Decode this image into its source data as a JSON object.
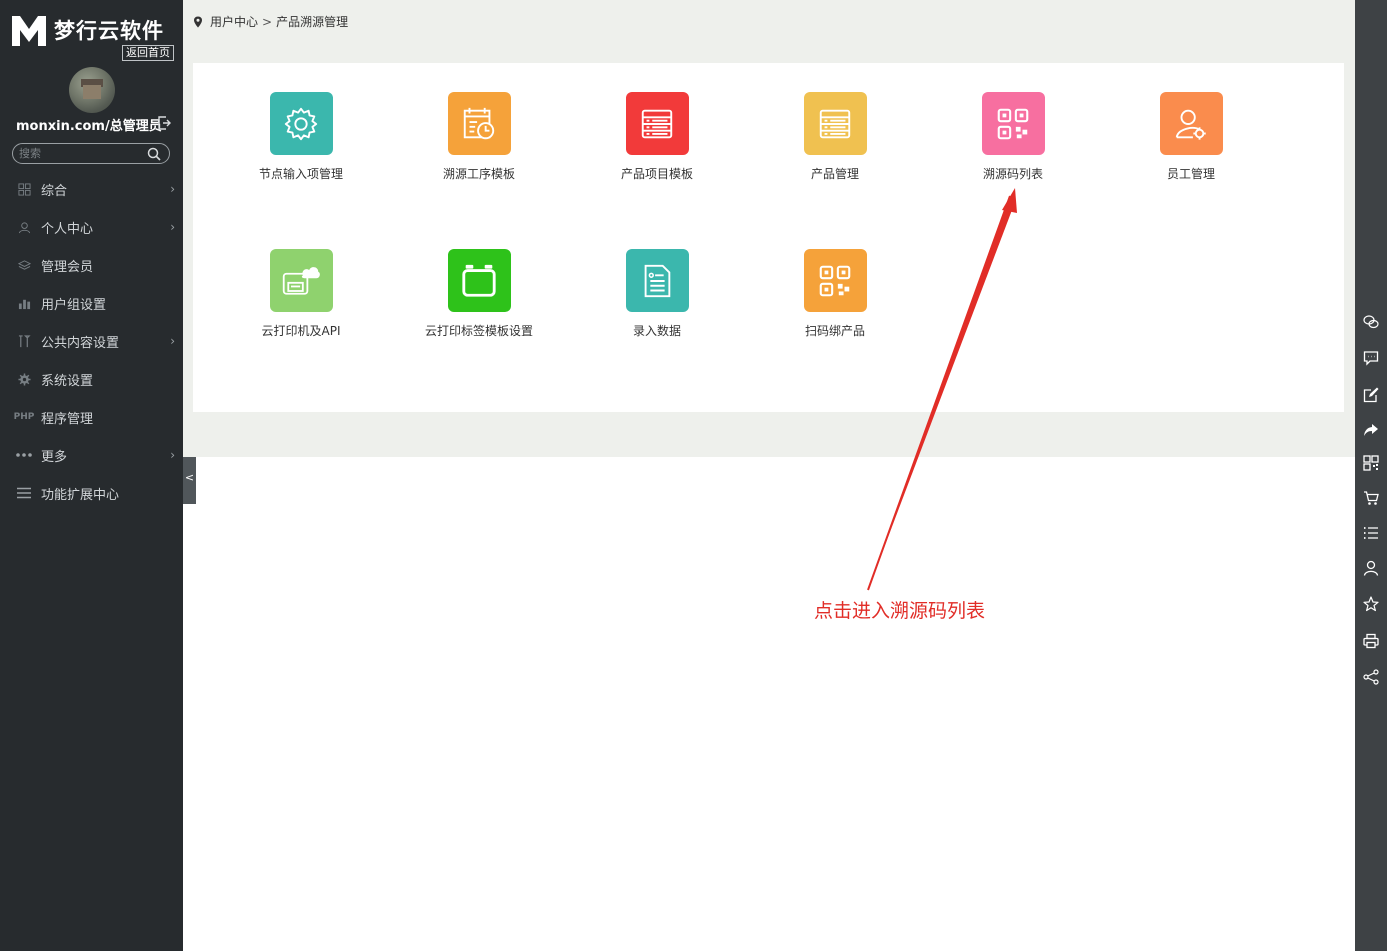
{
  "sidebar": {
    "brand": "梦行云软件",
    "back_home": "返回首页",
    "username": "monxin.com/总管理员",
    "search_placeholder": "搜索",
    "items": [
      {
        "label": "综合",
        "icon": "grid-icon",
        "arrow": true
      },
      {
        "label": "个人中心",
        "icon": "user-icon",
        "arrow": true
      },
      {
        "label": "管理会员",
        "icon": "layers-icon",
        "arrow": false
      },
      {
        "label": "用户组设置",
        "icon": "group-icon",
        "arrow": false
      },
      {
        "label": "公共内容设置",
        "icon": "tools-icon",
        "arrow": true
      },
      {
        "label": "系统设置",
        "icon": "gear-icon",
        "arrow": false
      },
      {
        "label": "程序管理",
        "icon": "php-icon",
        "arrow": false
      },
      {
        "label": "更多",
        "icon": "dots-icon",
        "arrow": true
      },
      {
        "label": "功能扩展中心",
        "icon": "menu-lines-icon",
        "arrow": false
      }
    ],
    "collapse_glyph": "<"
  },
  "breadcrumb": {
    "home": "用户中心",
    "separator": ">",
    "current": "产品溯源管理"
  },
  "tiles": [
    {
      "label": "节点输入项管理",
      "icon": "gear-icon",
      "color": "#3bb7ad"
    },
    {
      "label": "溯源工序模板",
      "icon": "calendar-clock-icon",
      "color": "#f5a23a"
    },
    {
      "label": "产品项目模板",
      "icon": "list-icon",
      "color": "#f23a3a"
    },
    {
      "label": "产品管理",
      "icon": "list-icon",
      "color": "#f0c150"
    },
    {
      "label": "溯源码列表",
      "icon": "qrcode-icon",
      "color": "#f76fa0"
    },
    {
      "label": "员工管理",
      "icon": "user-gear-icon",
      "color": "#fa8c4d"
    },
    {
      "label": "云打印机及API",
      "icon": "printer-cloud-icon",
      "color": "#8fd26e"
    },
    {
      "label": "云打印标签模板设置",
      "icon": "label-template-icon",
      "color": "#2ec21a"
    },
    {
      "label": "录入数据",
      "icon": "document-icon",
      "color": "#3bb7ad"
    },
    {
      "label": "扫码绑产品",
      "icon": "qrcode-icon",
      "color": "#f5a23a"
    }
  ],
  "annotation": {
    "text": "点击进入溯源码列表",
    "color": "#e12d27"
  },
  "rightbar": {
    "icons": [
      "wechat-icon",
      "message-icon",
      "edit-icon",
      "share-arrow-icon",
      "qrcode-icon",
      "cart-icon",
      "list-icon",
      "user-icon",
      "star-icon",
      "print-icon",
      "share-icon"
    ]
  }
}
